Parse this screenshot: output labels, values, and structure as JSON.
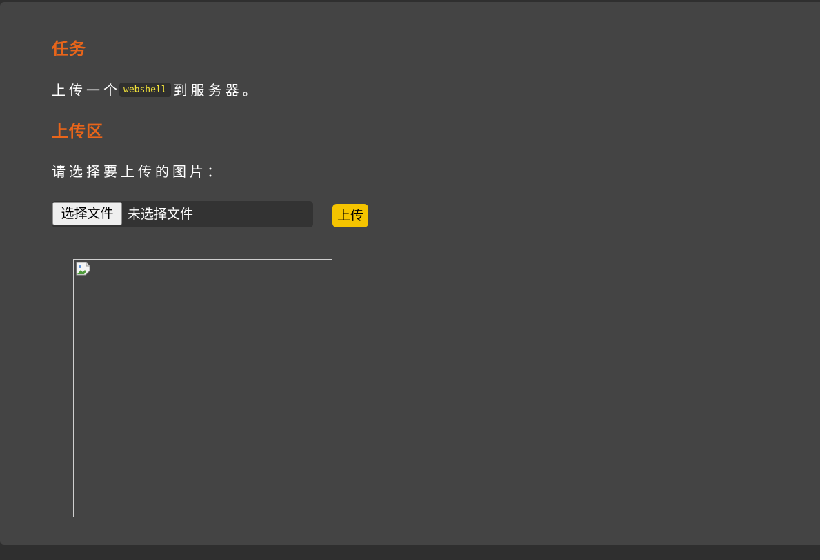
{
  "task": {
    "heading": "任务",
    "text_before": "上传一个",
    "code": "webshell",
    "text_after": "到服务器。"
  },
  "upload": {
    "heading": "上传区",
    "prompt": "请选择要上传的图片：",
    "file_button_label": "选择文件",
    "file_status": "未选择文件",
    "submit_label": "上传"
  },
  "preview": {
    "icon": "broken-image-icon"
  },
  "colors": {
    "heading": "#e8651a",
    "code_text": "#f2e23a",
    "submit_button": "#f5c400",
    "panel": "#444444"
  }
}
